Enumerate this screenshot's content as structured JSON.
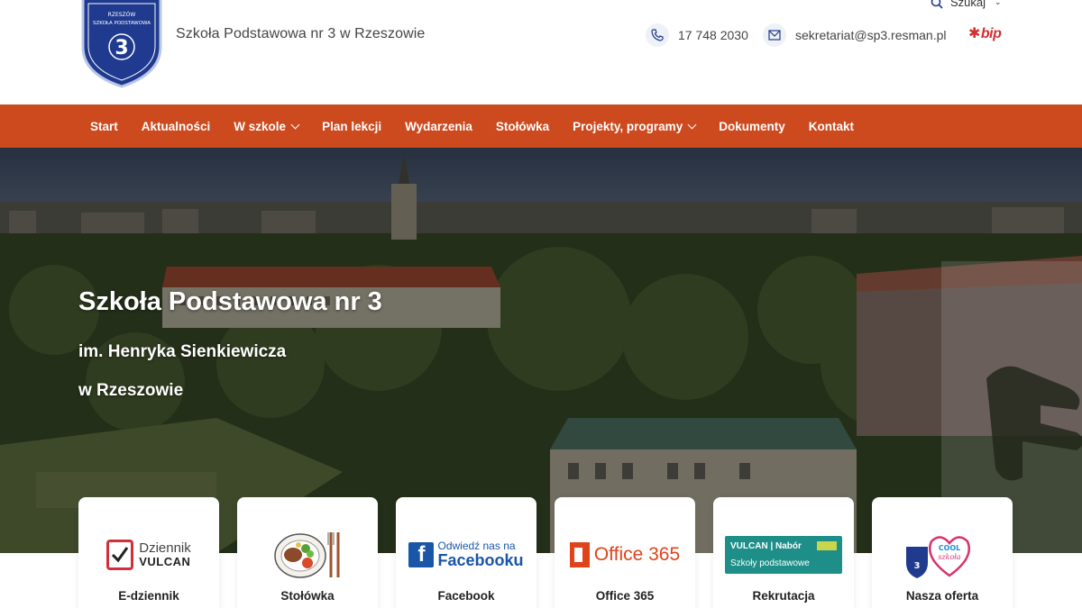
{
  "header": {
    "logo_text": {
      "line1": "RZESZÓW",
      "line2": "SZKOŁA PODSTAWOWA",
      "number": "3",
      "patron": "im. Henryka Sienkiewicza"
    },
    "school_name": "Szkoła Podstawowa nr 3 w Rzeszowie",
    "search_label": "Szukaj",
    "phone": "17 748 2030",
    "email": "sekretariat@sp3.resman.pl",
    "bip_label": "bip"
  },
  "nav": {
    "items": [
      {
        "label": "Start",
        "dropdown": false
      },
      {
        "label": "Aktualności",
        "dropdown": false
      },
      {
        "label": "W szkole",
        "dropdown": true
      },
      {
        "label": "Plan lekcji",
        "dropdown": false
      },
      {
        "label": "Wydarzenia",
        "dropdown": false
      },
      {
        "label": "Stołówka",
        "dropdown": false
      },
      {
        "label": "Projekty, programy",
        "dropdown": true
      },
      {
        "label": "Dokumenty",
        "dropdown": false
      },
      {
        "label": "Kontakt",
        "dropdown": false
      }
    ]
  },
  "hero": {
    "title": "Szkoła Podstawowa nr 3",
    "subtitle": "im. Henryka Sienkiewicza",
    "subtitle2": "w Rzeszowie"
  },
  "cards": [
    {
      "label": "E-dziennik",
      "icon": "vulcan-dziennik-icon",
      "icon_text1": "Dziennik",
      "icon_text2": "VULCAN"
    },
    {
      "label": "Stołówka",
      "icon": "plate-food-icon"
    },
    {
      "label": "Facebook",
      "icon": "facebook-icon",
      "icon_text1": "Odwiedź nas na",
      "icon_text2": "Facebooku"
    },
    {
      "label": "Office 365",
      "icon": "office365-icon",
      "icon_text1": "Office 365"
    },
    {
      "label": "Rekrutacja",
      "icon": "vulcan-nabor-icon",
      "icon_text1": "VULCAN | Nabór",
      "icon_text2": "Szkoły podstawowe"
    },
    {
      "label": "Nasza oferta",
      "icon": "cool-szkola-icon",
      "icon_text1": "COOL",
      "icon_text2": "szkoła"
    }
  ],
  "colors": {
    "accent": "#cd4a1e",
    "bip_red": "#d32f2f",
    "facebook_blue": "#1a56a8",
    "office_orange": "#e0431a",
    "vulcan_teal": "#1d8f88"
  }
}
